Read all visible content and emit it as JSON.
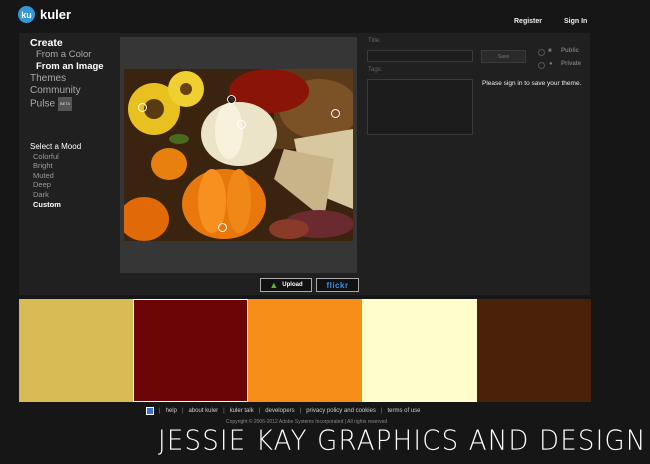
{
  "header": {
    "logo_text": "ku",
    "brand": "kuler",
    "register": "Register",
    "signin": "Sign In"
  },
  "nav": {
    "create": "Create",
    "from_color": "From a Color",
    "from_image": "From an Image",
    "themes": "Themes",
    "community": "Community",
    "pulse": "Pulse",
    "beta": "BETA"
  },
  "mood": {
    "title": "Select a Mood",
    "options": [
      "Colorful",
      "Bright",
      "Muted",
      "Deep",
      "Dark",
      "Custom"
    ],
    "selected": "Custom"
  },
  "form": {
    "title_label": "Title:",
    "tags_label": "Tags:",
    "save_label": "Save",
    "public_label": "Public",
    "private_label": "Private",
    "signin_message": "Please sign in to save your theme."
  },
  "upload": {
    "upload_label": "Upload",
    "flickr_label": "flickr"
  },
  "swatches": [
    "#d7bb55",
    "#6c0505",
    "#f78e17",
    "#fefecc",
    "#4a220a"
  ],
  "colors": {
    "accent": "#2f9ad6",
    "flickr_blue": "#0063dc",
    "flickr_pink": "#ff0084"
  },
  "footer": {
    "links": [
      "help",
      "about kuler",
      "kuler talk",
      "developers",
      "privacy policy and cookies",
      "terms of use"
    ],
    "copyright": "Copyright © 2006-2012 Adobe Systems Incorporated | All rights reserved"
  },
  "watermark": "JESSIE KAY GRAPHICS AND DESIGN"
}
